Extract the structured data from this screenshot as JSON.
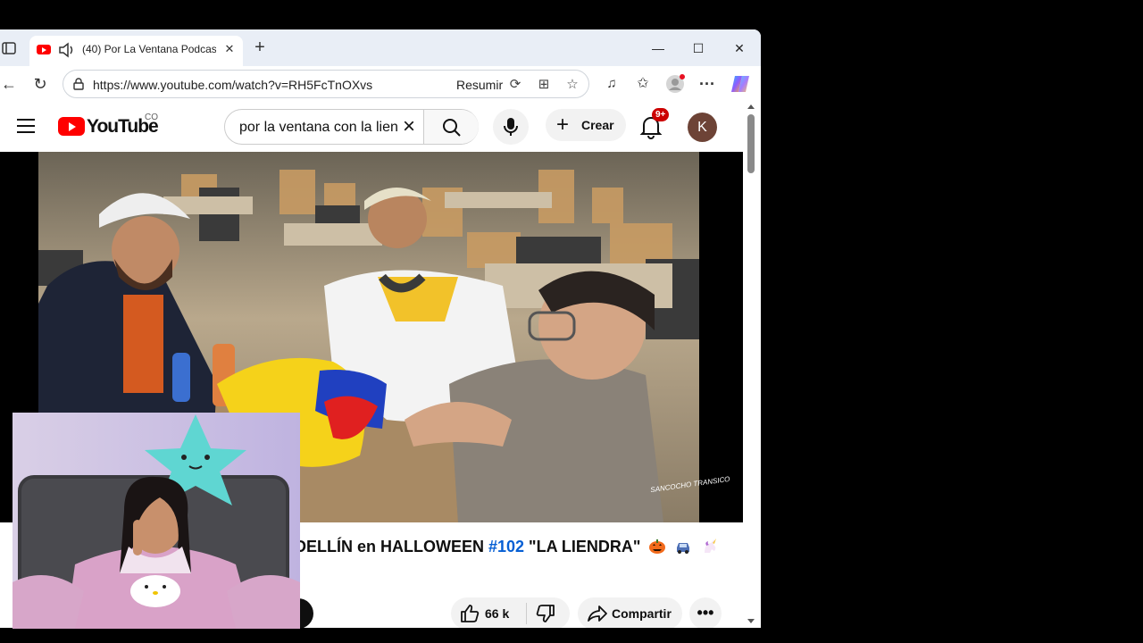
{
  "browser": {
    "tab_title": "(40) Por La Ventana Podcast",
    "url": "https://www.youtube.com/watch?v=RH5FcTnOXvs",
    "summarize_label": "Resumir"
  },
  "youtube": {
    "logo_text": "YouTube",
    "country_code": "CO",
    "search_value": "por la ventana con la lien",
    "create_label": "Crear",
    "notification_badge": "9+",
    "avatar_letter": "K",
    "watermark": "SANCOCHO TRANSICO"
  },
  "video": {
    "title_prefix": "DELLÍN en HALLOWEEN ",
    "title_hashtag": "#102",
    "title_suffix": " \"LA LIENDRA\"",
    "title_emojis": [
      "jack-o-lantern",
      "car",
      "unicorn"
    ],
    "like_count": "66 k",
    "share_label": "Compartir",
    "more_label": "•••"
  },
  "colors": {
    "youtube_red": "#ff0000",
    "link_blue": "#065fd4",
    "tab_strip": "#e9eef6",
    "badge_red": "#cc0000"
  }
}
